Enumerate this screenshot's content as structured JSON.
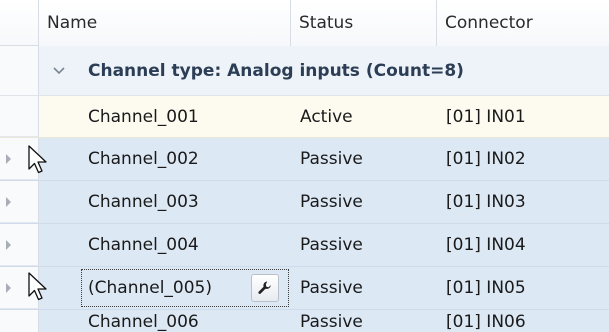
{
  "columns": {
    "name": "Name",
    "status": "Status",
    "connector": "Connector"
  },
  "group": {
    "label": "Channel type: Analog inputs (Count=8)"
  },
  "rows": [
    {
      "name": "Channel_001",
      "status": "Active",
      "connector": "[01] IN01"
    },
    {
      "name": "Channel_002",
      "status": "Passive",
      "connector": "[01] IN02"
    },
    {
      "name": "Channel_003",
      "status": "Passive",
      "connector": "[01] IN03"
    },
    {
      "name": "Channel_004",
      "status": "Passive",
      "connector": "[01] IN04"
    },
    {
      "name": "(Channel_005)",
      "status": "Passive",
      "connector": "[01] IN05"
    },
    {
      "name": "Channel_006",
      "status": "Passive",
      "connector": "[01] IN06"
    }
  ],
  "colors": {
    "active_row": "#fdfbf0",
    "selected_row": "#dde8f5",
    "group_row": "#eef3f9"
  },
  "icons": {
    "edit_button": "wrench-icon",
    "row_marker": "row-arrow-icon",
    "group_toggle": "chevron-down-icon",
    "pointer": "mouse-pointer-icon"
  }
}
